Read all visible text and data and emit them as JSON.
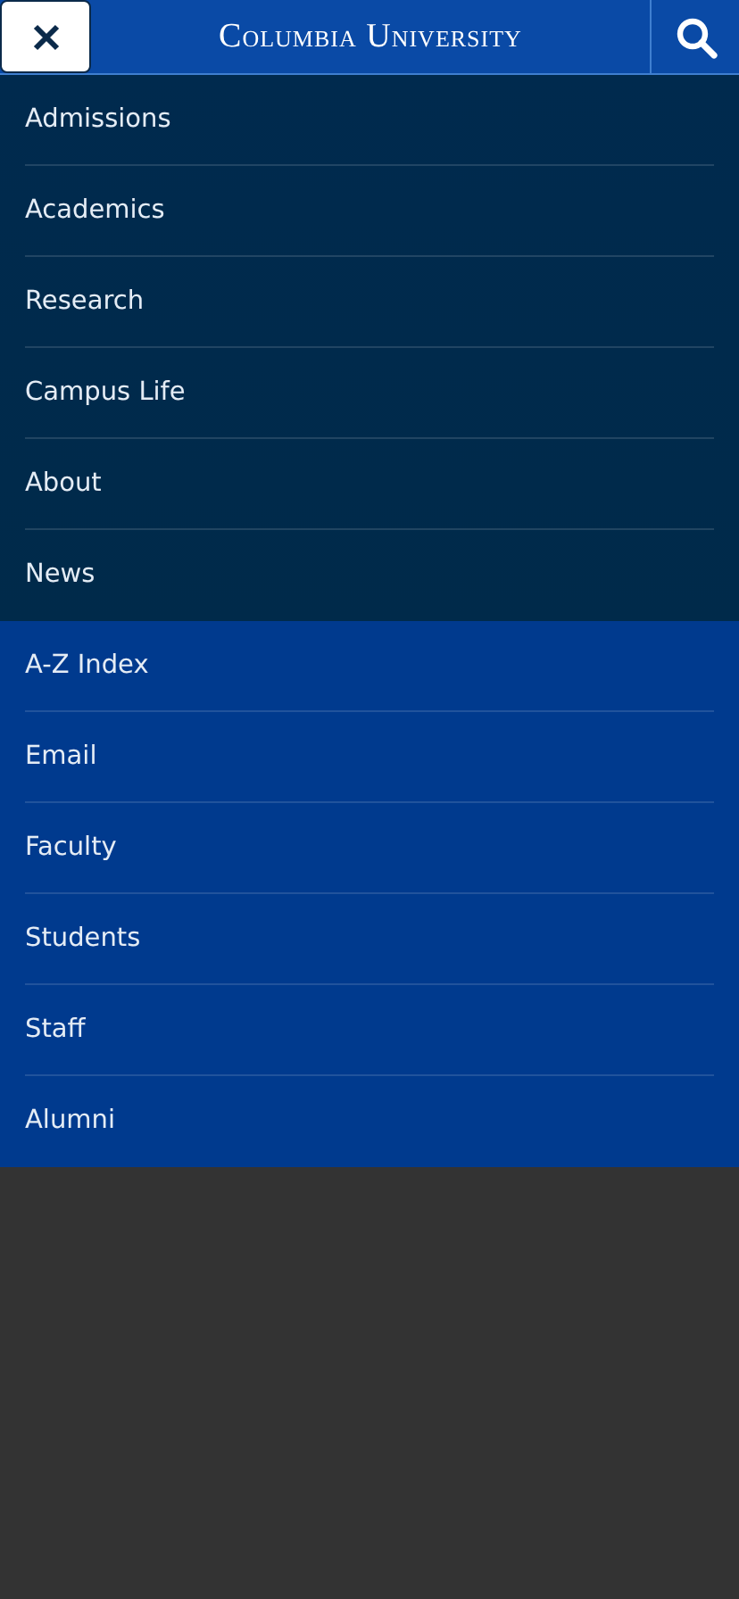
{
  "header": {
    "title": "Columbia University"
  },
  "primary_menu": [
    {
      "label": "Admissions"
    },
    {
      "label": "Academics"
    },
    {
      "label": "Research"
    },
    {
      "label": "Campus Life"
    },
    {
      "label": "About"
    },
    {
      "label": "News"
    }
  ],
  "secondary_menu": [
    {
      "label": "A-Z Index"
    },
    {
      "label": "Email"
    },
    {
      "label": "Faculty"
    },
    {
      "label": "Students"
    },
    {
      "label": "Staff"
    },
    {
      "label": "Alumni"
    }
  ]
}
